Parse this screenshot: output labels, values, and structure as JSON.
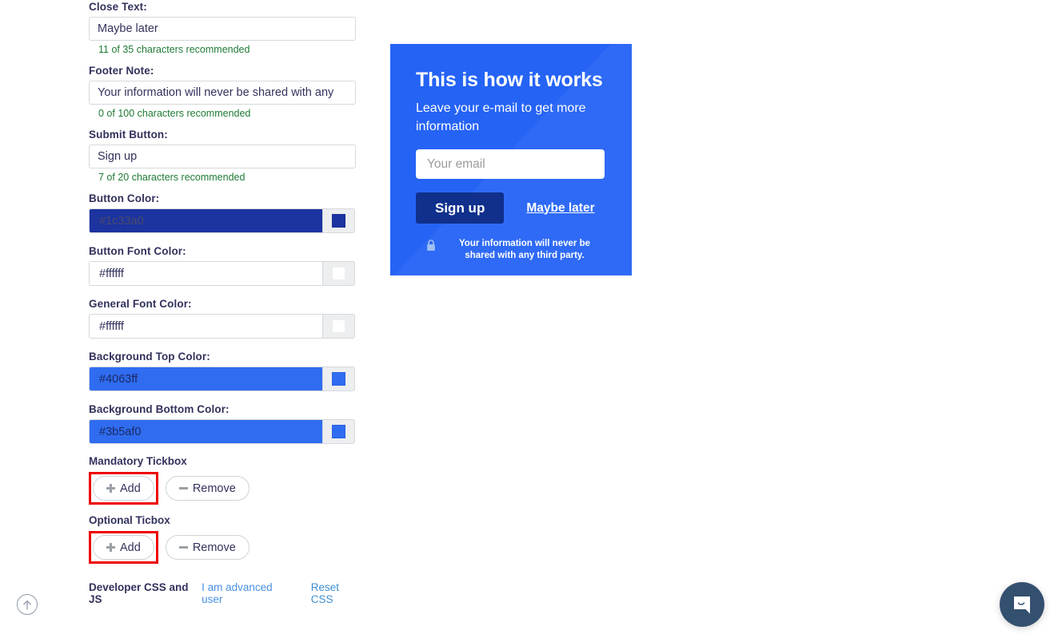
{
  "form": {
    "fields": [
      {
        "label": "Close Text:",
        "value": "Maybe later",
        "hint": "11 of 35 characters recommended",
        "name": "close-text"
      },
      {
        "label": "Footer Note:",
        "value": "Your information will never be shared with any",
        "hint": "0 of 100 characters recommended",
        "name": "footer-note"
      },
      {
        "label": "Submit Button:",
        "value": "Sign up",
        "hint": "7 of 20 characters recommended",
        "name": "submit-button-text"
      }
    ],
    "color_fields": [
      {
        "label": "Button Color:",
        "value": "#1c33a0",
        "field_bg": "#1c33a0",
        "field_text": "#4a4a6a",
        "chip": "#1c33a0",
        "name": "button-color"
      },
      {
        "label": "Button Font Color:",
        "value": "#ffffff",
        "field_bg": "#ffffff",
        "field_text": "#32325d",
        "chip": "#ffffff",
        "name": "button-font-color"
      },
      {
        "label": "General Font Color:",
        "value": "#ffffff",
        "field_bg": "#ffffff",
        "field_text": "#32325d",
        "chip": "#ffffff",
        "name": "general-font-color"
      },
      {
        "label": "Background Top Color:",
        "value": "#4063ff",
        "field_bg": "#2f6cf0",
        "field_text": "#1b2a66",
        "chip": "#2f6cf0",
        "name": "background-top-color"
      },
      {
        "label": "Background Bottom Color:",
        "value": "#3b5af0",
        "field_bg": "#2f6cf0",
        "field_text": "#1b2a66",
        "chip": "#2f6cf0",
        "name": "background-bottom-color"
      }
    ],
    "tickboxes": [
      {
        "label": "Mandatory Tickbox",
        "add_label": "Add",
        "remove_label": "Remove",
        "name": "mandatory-tickbox"
      },
      {
        "label": "Optional Ticbox",
        "add_label": "Add",
        "remove_label": "Remove",
        "name": "optional-ticbox"
      }
    ],
    "developer": {
      "title": "Developer CSS and JS",
      "advanced_link": "I am advanced user",
      "reset_link": "Reset CSS"
    }
  },
  "preview": {
    "title": "This is how it works",
    "subtitle": "Leave your e-mail to get more information",
    "email_placeholder": "Your email",
    "email_value": "",
    "submit_label": "Sign up",
    "close_label": "Maybe later",
    "footer_note": "Your information will never be shared with any third party.",
    "background_color": "#2563f5",
    "button_color": "#10308c",
    "font_color": "#ffffff"
  },
  "widgets": {
    "scroll_top_icon": "arrow-up-icon",
    "chat_icon": "chat-bubble-smile-icon"
  }
}
